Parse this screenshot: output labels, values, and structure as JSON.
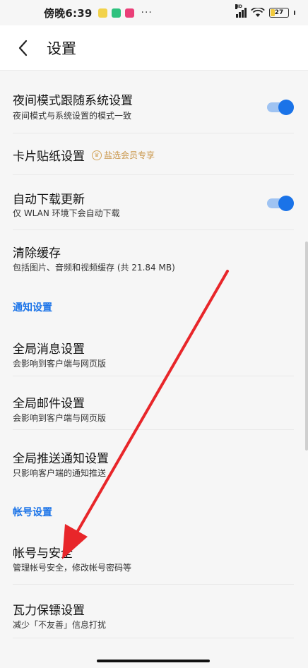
{
  "status_bar": {
    "time": "傍晚6:39",
    "dots": "···",
    "network_label": "HD",
    "battery_level": "27",
    "battery_fraction": 0.27
  },
  "header": {
    "title": "设置",
    "back_icon": "chevron-left-icon"
  },
  "rows": {
    "night_mode": {
      "title": "夜间模式跟随系统设置",
      "subtitle": "夜间模式与系统设置的模式一致",
      "toggle_on": true
    },
    "card_sticker": {
      "title": "卡片贴纸设置",
      "badge": "盐选会员专享"
    },
    "auto_update": {
      "title": "自动下载更新",
      "subtitle": "仅 WLAN 环境下会自动下载",
      "toggle_on": true
    },
    "clear_cache": {
      "title": "清除缓存",
      "subtitle": "包括图片、音频和视频缓存 (共 21.84 MB)"
    },
    "global_message": {
      "title": "全局消息设置",
      "subtitle": "会影响到客户端与网页版"
    },
    "global_mail": {
      "title": "全局邮件设置",
      "subtitle": "会影响到客户端与网页版"
    },
    "global_push": {
      "title": "全局推送通知设置",
      "subtitle": "只影响客户端的通知推送"
    },
    "account_security": {
      "title": "帐号与安全",
      "subtitle": "管理帐号安全，修改帐号密码等"
    },
    "wali_guard": {
      "title": "瓦力保镖设置",
      "subtitle": "减少「不友善」信息打扰"
    }
  },
  "sections": {
    "notification": "通知设置",
    "account": "帐号设置"
  },
  "colors": {
    "accent": "#1a73e8",
    "toggle_track": "#9fc3f2",
    "vip_gold": "#c9964a",
    "arrow": "#e8262a",
    "background": "#f6f6f6"
  }
}
